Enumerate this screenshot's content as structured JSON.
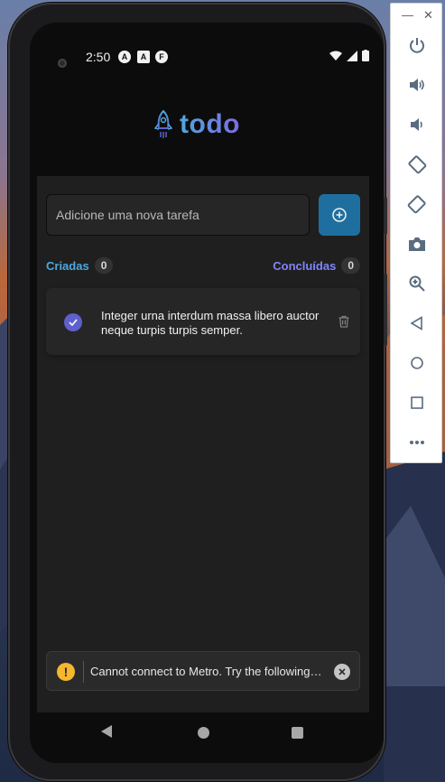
{
  "status_bar": {
    "time": "2:50",
    "icons": [
      "a-circle-icon",
      "a-square-icon",
      "f-circle-icon"
    ]
  },
  "app": {
    "title": "todo",
    "input_placeholder": "Adicione uma nova tarefa",
    "counters": {
      "created_label": "Criadas",
      "created_count": "0",
      "done_label": "Concluídas",
      "done_count": "0"
    },
    "tasks": [
      {
        "text": "Integer urna interdum massa libero auctor neque turpis turpis semper.",
        "done": true
      }
    ],
    "toast": {
      "message": "Cannot connect to Metro.  Try the following…"
    }
  },
  "colors": {
    "blue": "#4ea8de",
    "blue_dark": "#1e6f9f",
    "purple": "#8284fa",
    "purple_dark": "#5e60ce",
    "gray_700": "#0d0d0d",
    "gray_600": "#1a1a1a",
    "gray_500": "#262626"
  },
  "emulator_toolbar": {
    "buttons": [
      "power-icon",
      "volume-up-icon",
      "volume-down-icon",
      "rotate-left-icon",
      "rotate-right-icon",
      "camera-icon",
      "zoom-icon",
      "back-icon",
      "home-icon",
      "overview-icon",
      "more-icon"
    ]
  }
}
